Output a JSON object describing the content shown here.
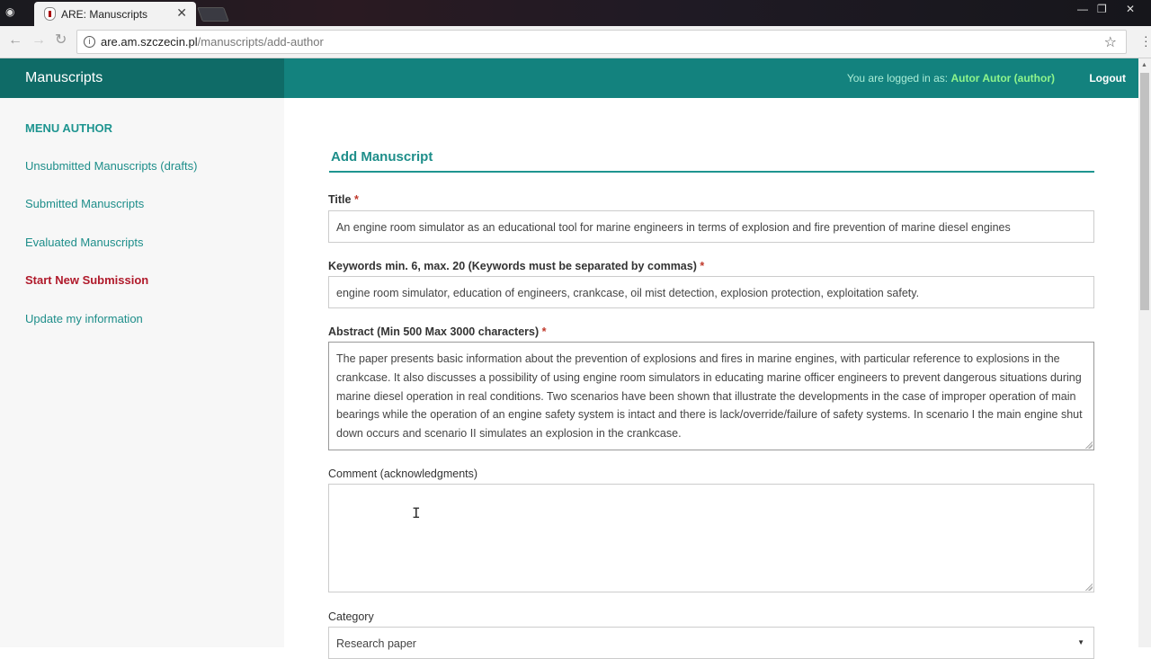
{
  "browser": {
    "tab_title": "ARE: Manuscripts",
    "url_host": "are.am.szczecin.pl",
    "url_path": "/manuscripts/add-author",
    "icons": [
      "incognito-icon",
      "back-icon",
      "forward-icon",
      "reload-icon",
      "info-icon",
      "star-icon",
      "menu-icon"
    ]
  },
  "header": {
    "brand": "Manuscripts",
    "logged_prefix": "You are logged in as:",
    "logged_user": "Autor Autor (author)",
    "logout": "Logout"
  },
  "sidebar": {
    "heading": "MENU AUTHOR",
    "items": [
      {
        "label": "Unsubmitted Manuscripts (drafts)"
      },
      {
        "label": "Submitted Manuscripts"
      },
      {
        "label": "Evaluated Manuscripts"
      },
      {
        "label": "Start New Submission"
      },
      {
        "label": "Update my information"
      }
    ]
  },
  "form": {
    "title": "Add Manuscript",
    "title_label": "Title",
    "title_value": "An engine room simulator as an educational tool for marine engineers in terms of explosion and fire prevention of marine diesel engines",
    "keywords_label": "Keywords min. 6, max. 20 (Keywords must be separated by commas)",
    "keywords_value": "engine room simulator, education of engineers, crankcase, oil mist detection, explosion protection, exploitation safety.",
    "abstract_label": "Abstract (Min 500 Max 3000 characters)",
    "abstract_value": "The paper presents basic information about the prevention of explosions and fires in marine engines, with particular reference to explosions in the crankcase. It also discusses a possibility of using engine room simulators in educating marine officer engineers to prevent dangerous situations during marine diesel operation in real conditions. Two scenarios have been shown that illustrate the developments in the case of improper operation of main bearings while the operation of an engine safety system is intact and there is lack/override/failure of safety systems. In scenario I the main engine shut down occurs and scenario II simulates an explosion in the crankcase.",
    "comment_label": "Comment (acknowledgments)",
    "comment_value": "",
    "category_label": "Category",
    "category_value": "Research paper",
    "required_mark": "*"
  },
  "colors": {
    "brand": "#0f6b67",
    "topbar": "#13827e",
    "accent": "#1e9590",
    "active": "#b01a2b"
  }
}
